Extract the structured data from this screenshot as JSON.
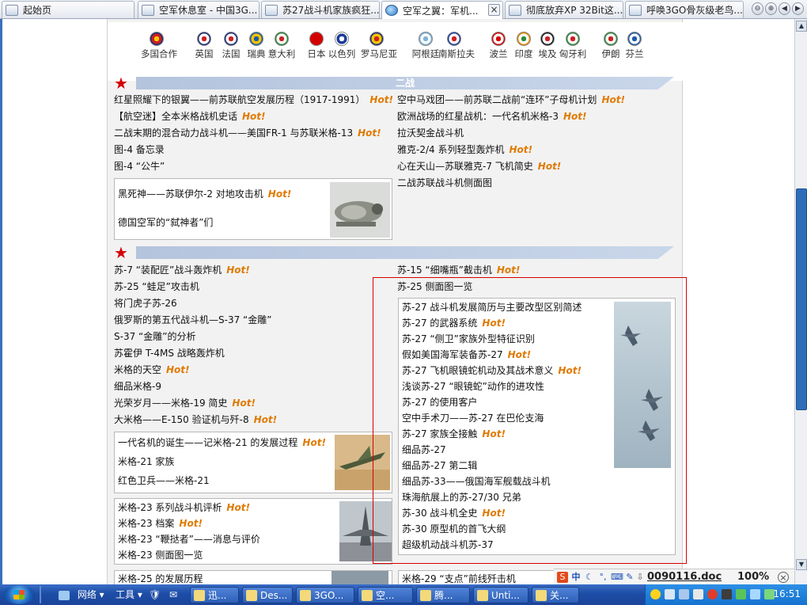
{
  "tabs": [
    {
      "label": "起始页"
    },
    {
      "label": "空军休息室 - 中国3G..."
    },
    {
      "label": "苏27战斗机家族疯狂..."
    },
    {
      "label": "空军之翼：军机..."
    },
    {
      "label": "彻底放弃XP 32Bit这..."
    },
    {
      "label": "呼唤3GO骨灰级老鸟..."
    }
  ],
  "tab_close": "×",
  "tab_nav": [
    "⊖",
    "⊕",
    "◀",
    "▶",
    "▾"
  ],
  "flags": [
    {
      "label": "多国合作",
      "colors": [
        "#1a2a7a",
        "#cc2020",
        "#ffcc00"
      ]
    },
    {
      "label": "英国",
      "colors": [
        "#1a2a7a",
        "#ffffff",
        "#cc2020"
      ]
    },
    {
      "label": "法国",
      "colors": [
        "#1a2a7a",
        "#ffffff",
        "#cc2020"
      ]
    },
    {
      "label": "瑞典",
      "colors": [
        "#1c5aa8",
        "#f2c400",
        "#1c5aa8"
      ]
    },
    {
      "label": "意大利",
      "colors": [
        "#2a8a3a",
        "#ffffff",
        "#cc2020"
      ]
    },
    {
      "label": "日本",
      "colors": [
        "#d40000",
        "#d40000",
        "#d40000"
      ]
    },
    {
      "label": "以色列",
      "colors": [
        "#ffffff",
        "#1a3a9a",
        "#ffffff"
      ]
    },
    {
      "label": "罗马尼亚",
      "colors": [
        "#1a2a7a",
        "#f2c400",
        "#cc2020"
      ]
    },
    {
      "label": "阿根廷",
      "colors": [
        "#7fb3d8",
        "#ffffff",
        "#7fb3d8"
      ]
    },
    {
      "label": "南斯拉夫",
      "colors": [
        "#1a3a9a",
        "#ffffff",
        "#cc2020"
      ]
    },
    {
      "label": "波兰",
      "colors": [
        "#d40000",
        "#ffffff",
        "#d40000"
      ]
    },
    {
      "label": "印度",
      "colors": [
        "#f08a00",
        "#ffffff",
        "#2a8a3a"
      ]
    },
    {
      "label": "埃及",
      "colors": [
        "#111111",
        "#ffffff",
        "#cc2020"
      ]
    },
    {
      "label": "匈牙利",
      "colors": [
        "#2a8a3a",
        "#ffffff",
        "#cc2020"
      ]
    },
    {
      "label": "伊朗",
      "colors": [
        "#2a8a3a",
        "#ffffff",
        "#cc2020"
      ]
    },
    {
      "label": "芬兰",
      "colors": [
        "#1c5aa8",
        "#ffffff",
        "#1c5aa8"
      ]
    }
  ],
  "hot_label": "Hot!",
  "section1": {
    "title": "二战",
    "left": [
      {
        "text": "红星照耀下的银翼——前苏联航空发展历程（1917-1991）",
        "hot": true
      },
      {
        "text": "【航空迷】全本米格战机史话",
        "hot": true
      },
      {
        "text": "二战末期的混合动力战斗机——美国FR-1 与苏联米格-13",
        "hot": true
      },
      {
        "text": "图-4 备忘录",
        "hot": false
      },
      {
        "text": "图-4 “公牛”",
        "hot": false
      }
    ],
    "right": [
      {
        "text": "空中马戏团——前苏联二战前“连环”子母机计划",
        "hot": true
      },
      {
        "text": "欧洲战场的红星战机：一代名机米格-3",
        "hot": true
      },
      {
        "text": "拉沃契金战斗机",
        "hot": false
      },
      {
        "text": "雅克-2/4 系列轻型轰炸机",
        "hot": true
      },
      {
        "text": "心在天山—苏联雅克-7 飞机简史",
        "hot": true
      },
      {
        "text": "二战苏联战斗机侧面图",
        "hot": false
      }
    ],
    "box": [
      {
        "text": "黑死神——苏联伊尔-2 对地攻击机",
        "hot": true
      },
      {
        "text": "德国空军的“弑神者”们",
        "hot": false
      }
    ]
  },
  "section2": {
    "title": "",
    "left": [
      {
        "text": "苏-7 “装配匠”战斗轰炸机",
        "hot": true
      },
      {
        "text": "苏-25 “蛙足”攻击机",
        "hot": false
      },
      {
        "text": "将门虎子苏-26",
        "hot": false
      },
      {
        "text": "俄罗斯的第五代战斗机—S-37 “金雕”",
        "hot": false
      },
      {
        "text": "S-37 “金雕”的分析",
        "hot": false
      },
      {
        "text": "苏霍伊  T-4MS 战略轰炸机",
        "hot": false
      },
      {
        "text": "米格的天空",
        "hot": true
      },
      {
        "text": "细品米格-9",
        "hot": false
      },
      {
        "text": "光荣岁月——米格-19 简史",
        "hot": true
      },
      {
        "text": "大米格——E-150 验证机与歼-8",
        "hot": true
      }
    ],
    "right_top": [
      {
        "text": "苏-15 “细嘴瓶”截击机",
        "hot": true
      },
      {
        "text": "苏-25 侧面图一览",
        "hot": false
      }
    ],
    "box_mig21": [
      {
        "text": "一代名机的诞生——记米格-21 的发展过程",
        "hot": true
      },
      {
        "text": "米格-21 家族",
        "hot": false
      },
      {
        "text": "红色卫兵——米格-21",
        "hot": false
      }
    ],
    "box_mig23": [
      {
        "text": "米格-23 系列战斗机评析",
        "hot": true
      },
      {
        "text": "米格-23 档案",
        "hot": true
      },
      {
        "text": "米格-23 “鞭挞者”——消息与评价",
        "hot": false
      },
      {
        "text": "米格-23 侧面图一览",
        "hot": false
      }
    ],
    "box_mig25": [
      {
        "text": "米格-25 的发展历程",
        "hot": false
      }
    ],
    "box_su27": [
      {
        "text": "苏-27 战斗机发展简历与主要改型区别简述",
        "hot": false
      },
      {
        "text": "苏-27 的武器系统",
        "hot": true
      },
      {
        "text": "苏-27 “侧卫”家族外型特征识别",
        "hot": false
      },
      {
        "text": "假如美国海军装备苏-27",
        "hot": true
      },
      {
        "text": "苏-27 飞机眼镜蛇机动及其战术意义",
        "hot": true
      },
      {
        "text": "浅谈苏-27 “眼镜蛇”动作的进攻性",
        "hot": false
      },
      {
        "text": "苏-27 的使用客户",
        "hot": false
      },
      {
        "text": "空中手术刀——苏-27 在巴伦支海",
        "hot": false
      },
      {
        "text": "苏-27 家族全接触",
        "hot": true
      },
      {
        "text": "细品苏-27",
        "hot": false
      },
      {
        "text": "细品苏-27 第二辑",
        "hot": false
      },
      {
        "text": "细品苏-33——俄国海军舰载战斗机",
        "hot": false
      },
      {
        "text": "珠海航展上的苏-27/30 兄弟",
        "hot": false
      },
      {
        "text": "苏-30 战斗机全史",
        "hot": true
      },
      {
        "text": "苏-30 原型机的首飞大纲",
        "hot": false
      },
      {
        "text": "超级机动战斗机苏-37",
        "hot": false
      }
    ],
    "box_mig29": [
      {
        "text": "米格-29 “支点”前线歼击机",
        "hot": false
      }
    ]
  },
  "statusbar": {
    "doc": "0090116.doc",
    "zoom": "100%",
    "ime": "中"
  },
  "taskbar": {
    "network": "网络",
    "tools": "工具",
    "buttons": [
      "迅...",
      "Des...",
      "3GO...",
      "空...",
      "腾...",
      "Unti...",
      "关..."
    ],
    "clock": "16:51"
  }
}
